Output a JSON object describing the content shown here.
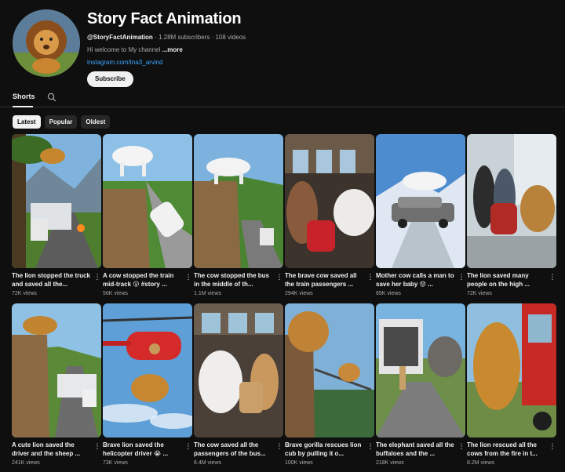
{
  "channel": {
    "name": "Story Fact Animation",
    "handle": "@StoryFactAnimation",
    "subscribers": "1.28M subscribers",
    "videos": "108 videos",
    "separator": "·",
    "description": "Hi welcome to My channel ",
    "more_label": "...more",
    "link": "instagram.com/tna3_arvind",
    "subscribe_label": "Subscribe"
  },
  "tabs": {
    "shorts_label": "Shorts"
  },
  "chips": [
    {
      "label": "Latest",
      "active": true
    },
    {
      "label": "Popular",
      "active": false
    },
    {
      "label": "Oldest",
      "active": false
    }
  ],
  "videos": [
    {
      "title": "The lion stopped the truck and saved all the...",
      "views": "72K views"
    },
    {
      "title": "A cow stopped the train mid-track 😮 #story ...",
      "views": "56K views"
    },
    {
      "title": "The cow stopped the bus in the middle of th...",
      "views": "1.1M views"
    },
    {
      "title": "The brave cow saved all the train passengers ...",
      "views": "294K views"
    },
    {
      "title": "Mother cow calls a man to save her baby 😟 ...",
      "views": "65K views"
    },
    {
      "title": "The lion saved many people on the high ...",
      "views": "72K views"
    },
    {
      "title": "A cute lion saved the driver and the sheep ...",
      "views": "241K views"
    },
    {
      "title": "Brave lion saved the helicopter driver 😭 ...",
      "views": "73K views"
    },
    {
      "title": "The cow saved all the passengers of the bus...",
      "views": "6.4M views"
    },
    {
      "title": "Brave gorilla rescues lion cub by pulling it o...",
      "views": "100K views"
    },
    {
      "title": "The elephant saved all the buffaloes and the ...",
      "views": "218K views"
    },
    {
      "title": "The lion rescued all the cows from the fire in t...",
      "views": "8.2M views"
    }
  ],
  "colors": {
    "background": "#0f0f0f",
    "link": "#3ea6ff",
    "muted": "#aaaaaa"
  },
  "icons": {
    "search": "search-icon",
    "more": "more-vert-icon"
  }
}
